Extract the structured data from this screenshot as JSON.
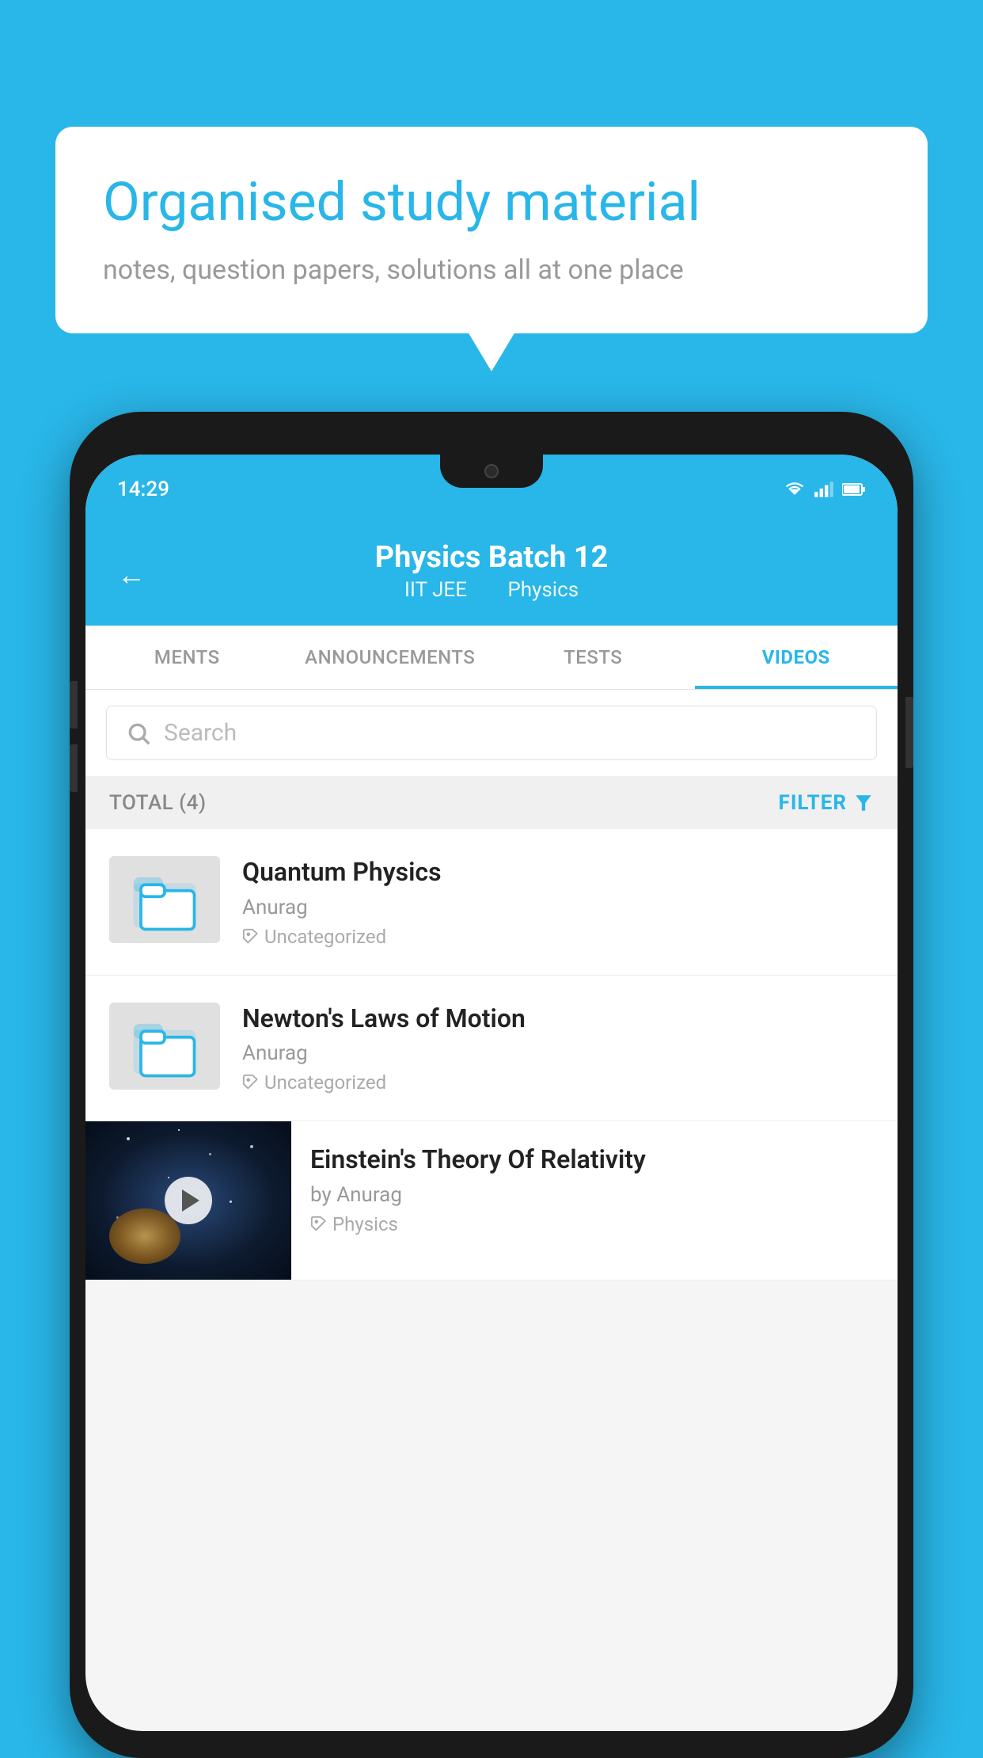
{
  "background_color": "#29b6e8",
  "speech_bubble": {
    "title": "Organised study material",
    "subtitle": "notes, question papers, solutions all at one place"
  },
  "phone": {
    "status_bar": {
      "time": "14:29",
      "wifi": "▼▲",
      "signal": "▲",
      "battery": "▮"
    },
    "header": {
      "back_label": "←",
      "title": "Physics Batch 12",
      "subtitle_part1": "IIT JEE",
      "subtitle_part2": "Physics"
    },
    "tabs": [
      {
        "label": "MENTS",
        "active": false
      },
      {
        "label": "ANNOUNCEMENTS",
        "active": false
      },
      {
        "label": "TESTS",
        "active": false
      },
      {
        "label": "VIDEOS",
        "active": true
      }
    ],
    "search": {
      "placeholder": "Search"
    },
    "filter_row": {
      "total_label": "TOTAL (4)",
      "filter_label": "FILTER"
    },
    "videos": [
      {
        "id": "1",
        "title": "Quantum Physics",
        "author": "Anurag",
        "tag": "Uncategorized",
        "has_thumbnail": false
      },
      {
        "id": "2",
        "title": "Newton's Laws of Motion",
        "author": "Anurag",
        "tag": "Uncategorized",
        "has_thumbnail": false
      },
      {
        "id": "3",
        "title": "Einstein's Theory Of Relativity",
        "author_prefix": "by",
        "author": "Anurag",
        "tag": "Physics",
        "has_thumbnail": true
      }
    ]
  }
}
